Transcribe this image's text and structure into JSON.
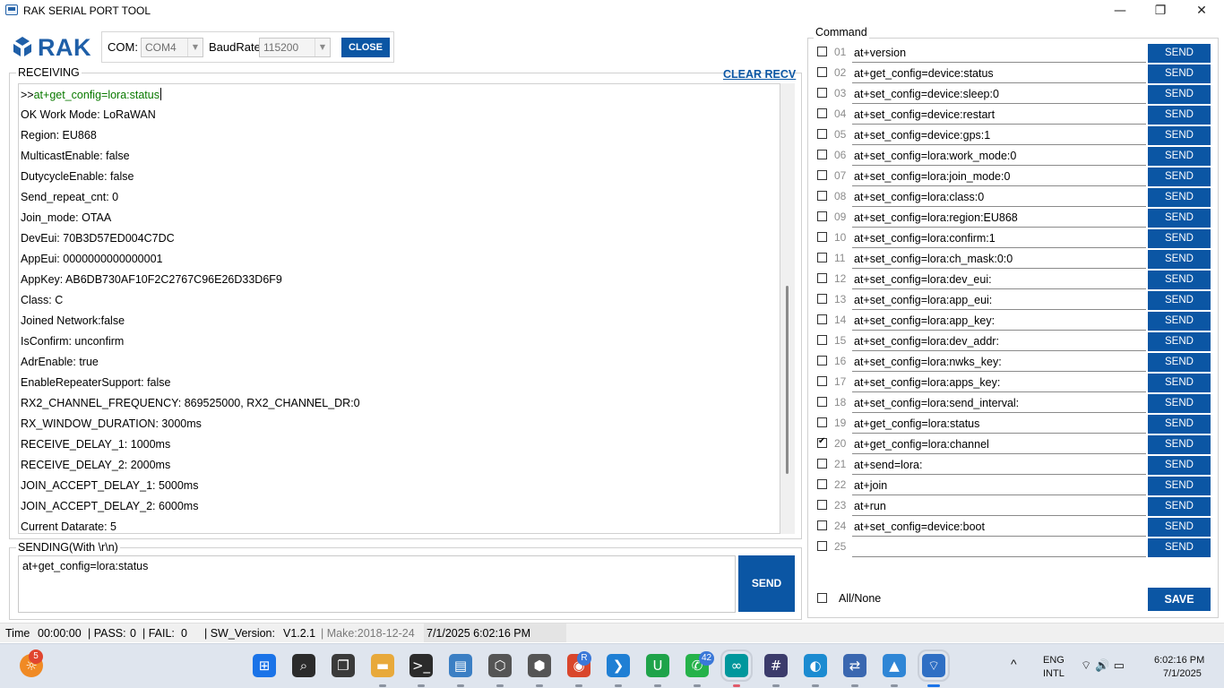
{
  "window": {
    "title": "RAK SERIAL PORT TOOL",
    "minimize": "—",
    "restore": "❐",
    "close": "✕"
  },
  "logo": {
    "text": "RAK"
  },
  "com": {
    "com_label": "COM:",
    "com_value": "COM4",
    "baud_label": "BaudRate:",
    "baud_value": "115200",
    "close_button": "CLOSE"
  },
  "receiving": {
    "label": "RECEIVING",
    "clear_label": "CLEAR RECV",
    "command_prefix": ">>",
    "command_echo": "at+get_config=lora:status",
    "lines": [
      "OK Work Mode: LoRaWAN",
      "Region: EU868",
      "MulticastEnable: false",
      "DutycycleEnable: false",
      "Send_repeat_cnt: 0",
      "Join_mode: OTAA",
      "DevEui: 70B3D57ED004C7DC",
      "AppEui: 0000000000000001",
      "AppKey: AB6DB730AF10F2C2767C96E26D33D6F9",
      "Class: C",
      "Joined Network:false",
      "IsConfirm: unconfirm",
      "AdrEnable: true",
      "EnableRepeaterSupport: false",
      "RX2_CHANNEL_FREQUENCY: 869525000, RX2_CHANNEL_DR:0",
      "RX_WINDOW_DURATION: 3000ms",
      "RECEIVE_DELAY_1: 1000ms",
      "RECEIVE_DELAY_2: 2000ms",
      "JOIN_ACCEPT_DELAY_1: 5000ms",
      "JOIN_ACCEPT_DELAY_2: 6000ms",
      "Current Datarate: 5"
    ]
  },
  "sending": {
    "label": "SENDING(With \\r\\n)",
    "value": "at+get_config=lora:status",
    "send_button": "SEND"
  },
  "status": {
    "time_label": "Time",
    "time_value": "00:00:00",
    "pass_label": "| PASS:",
    "pass_value": "0",
    "fail_label": "| FAIL:",
    "fail_value": "0",
    "sw_label": "| SW_Version:",
    "sw_value": "V1.2.1",
    "make": "| Make:2018-12-24",
    "datetime": "7/1/2025 6:02:16 PM"
  },
  "command_panel": {
    "label": "Command",
    "send_label": "SEND",
    "all_none_label": "All/None",
    "all_none_checked": false,
    "save_button": "SAVE",
    "rows": [
      {
        "num": "01",
        "cmd": "at+version",
        "checked": false
      },
      {
        "num": "02",
        "cmd": "at+get_config=device:status",
        "checked": false
      },
      {
        "num": "03",
        "cmd": "at+set_config=device:sleep:0",
        "checked": false
      },
      {
        "num": "04",
        "cmd": "at+set_config=device:restart",
        "checked": false
      },
      {
        "num": "05",
        "cmd": "at+set_config=device:gps:1",
        "checked": false
      },
      {
        "num": "06",
        "cmd": "at+set_config=lora:work_mode:0",
        "checked": false
      },
      {
        "num": "07",
        "cmd": "at+set_config=lora:join_mode:0",
        "checked": false
      },
      {
        "num": "08",
        "cmd": "at+set_config=lora:class:0",
        "checked": false
      },
      {
        "num": "09",
        "cmd": "at+set_config=lora:region:EU868",
        "checked": false
      },
      {
        "num": "10",
        "cmd": "at+set_config=lora:confirm:1",
        "checked": false
      },
      {
        "num": "11",
        "cmd": "at+set_config=lora:ch_mask:0:0",
        "checked": false
      },
      {
        "num": "12",
        "cmd": "at+set_config=lora:dev_eui:",
        "checked": false
      },
      {
        "num": "13",
        "cmd": "at+set_config=lora:app_eui:",
        "checked": false
      },
      {
        "num": "14",
        "cmd": "at+set_config=lora:app_key:",
        "checked": false
      },
      {
        "num": "15",
        "cmd": "at+set_config=lora:dev_addr:",
        "checked": false
      },
      {
        "num": "16",
        "cmd": "at+set_config=lora:nwks_key:",
        "checked": false
      },
      {
        "num": "17",
        "cmd": "at+set_config=lora:apps_key:",
        "checked": false
      },
      {
        "num": "18",
        "cmd": "at+set_config=lora:send_interval:",
        "checked": false
      },
      {
        "num": "19",
        "cmd": "at+get_config=lora:status",
        "checked": false
      },
      {
        "num": "20",
        "cmd": "at+get_config=lora:channel",
        "checked": true
      },
      {
        "num": "21",
        "cmd": "at+send=lora:",
        "checked": false
      },
      {
        "num": "22",
        "cmd": "at+join",
        "checked": false
      },
      {
        "num": "23",
        "cmd": "at+run",
        "checked": false
      },
      {
        "num": "24",
        "cmd": "at+set_config=device:boot",
        "checked": false
      },
      {
        "num": "25",
        "cmd": "",
        "checked": false
      }
    ]
  },
  "taskbar": {
    "apps": [
      {
        "name": "start-icon",
        "glyph": "⊞",
        "color": "#1a73e8"
      },
      {
        "name": "search-icon",
        "glyph": "⌕",
        "color": "#2b2b2b"
      },
      {
        "name": "task-view-icon",
        "glyph": "❐",
        "color": "#3a3a3a"
      },
      {
        "name": "file-explorer-icon",
        "glyph": "▬",
        "color": "#e8a93b"
      },
      {
        "name": "terminal-icon",
        "glyph": ">_",
        "color": "#2b2b2b"
      },
      {
        "name": "app-window-icon",
        "glyph": "▤",
        "color": "#3b7fc4"
      },
      {
        "name": "box-icon",
        "glyph": "⬡",
        "color": "#555555"
      },
      {
        "name": "settings-box-icon",
        "glyph": "⬢",
        "color": "#555555"
      },
      {
        "name": "chrome-icon",
        "glyph": "◉",
        "color": "#d9462c"
      },
      {
        "name": "vscode-icon",
        "glyph": "❯",
        "color": "#1f7fd4"
      },
      {
        "name": "upwork-icon",
        "glyph": "U",
        "color": "#1fa34a"
      },
      {
        "name": "whatsapp-icon",
        "glyph": "✆",
        "color": "#25b24a"
      },
      {
        "name": "arduino-icon",
        "glyph": "∞",
        "color": "#00979c"
      },
      {
        "name": "slack-icon",
        "glyph": "#",
        "color": "#3b3b6b"
      },
      {
        "name": "edge-icon",
        "glyph": "◐",
        "color": "#1b8bd1"
      },
      {
        "name": "network-tool-icon",
        "glyph": "⇄",
        "color": "#3a67b0"
      },
      {
        "name": "photos-icon",
        "glyph": "▲",
        "color": "#2f86d6"
      },
      {
        "name": "rak-tool-icon",
        "glyph": "⌔",
        "color": "#2f6fc4"
      }
    ],
    "weather_badge": "5",
    "chrome_badge": "R",
    "whatsapp_badge": "42",
    "lang_top": "ENG",
    "lang_bottom": "INTL",
    "clock_time": "6:02:16 PM",
    "clock_date": "7/1/2025",
    "tray_chevron": "^",
    "tray_icons": "⌔ 🔊 ▭"
  }
}
